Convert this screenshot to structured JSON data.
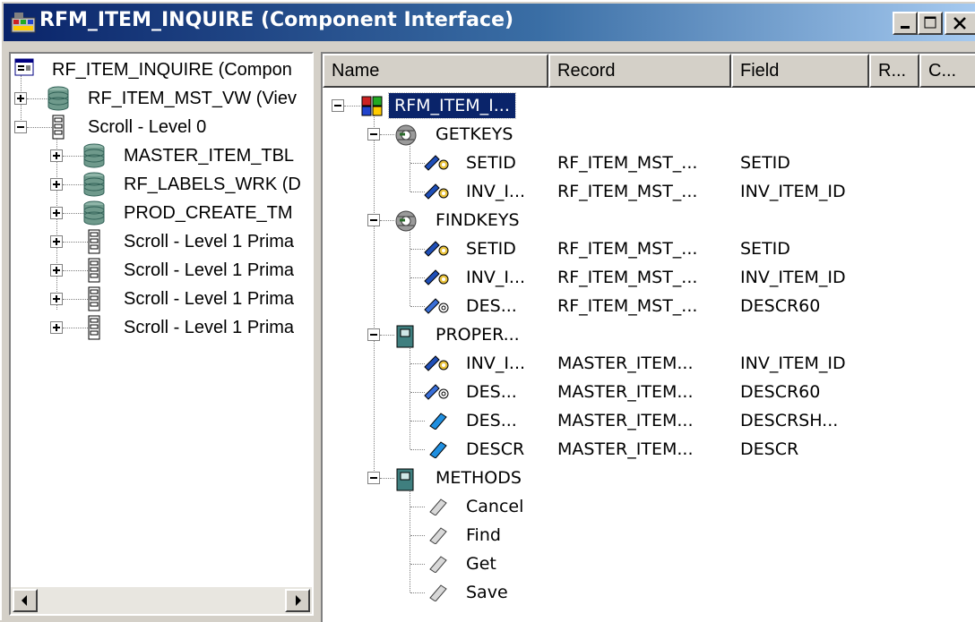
{
  "window": {
    "title": "RFM_ITEM_INQUIRE (Component Interface)",
    "icon": "component-interface-icon"
  },
  "left_tree": [
    {
      "label": "RF_ITEM_INQUIRE (Compon",
      "icon": "component-icon",
      "expander": null
    },
    {
      "label": "RF_ITEM_MST_VW (Viev",
      "icon": "database-icon",
      "expander": "plus"
    },
    {
      "label": "Scroll - Level 0",
      "icon": "scroll-icon",
      "expander": "minus"
    },
    {
      "label": "MASTER_ITEM_TBL",
      "icon": "database-icon",
      "expander": "plus"
    },
    {
      "label": "RF_LABELS_WRK (D",
      "icon": "database-icon",
      "expander": "plus"
    },
    {
      "label": "PROD_CREATE_TM",
      "icon": "database-icon",
      "expander": "plus"
    },
    {
      "label": "Scroll - Level 1  Prima",
      "icon": "scroll-icon",
      "expander": "plus"
    },
    {
      "label": "Scroll - Level 1  Prima",
      "icon": "scroll-icon",
      "expander": "plus"
    },
    {
      "label": "Scroll - Level 1  Prima",
      "icon": "scroll-icon",
      "expander": "plus"
    },
    {
      "label": "Scroll - Level 1  Prima",
      "icon": "scroll-icon",
      "expander": "plus"
    }
  ],
  "columns": [
    "Name",
    "Record",
    "Field",
    "R...",
    "C..."
  ],
  "right_tree": [
    {
      "name": "RFM_ITEM_I...",
      "record": "",
      "field": "",
      "icon": "component-interface-icon",
      "level": 0,
      "selected": true
    },
    {
      "name": "GETKEYS",
      "record": "",
      "field": "",
      "icon": "keys-group-icon",
      "level": 1
    },
    {
      "name": "SETID",
      "record": "RF_ITEM_MST_...",
      "field": "SETID",
      "icon": "key-icon",
      "level": 2
    },
    {
      "name": "INV_I...",
      "record": "RF_ITEM_MST_...",
      "field": "INV_ITEM_ID",
      "icon": "key-icon",
      "level": 2
    },
    {
      "name": "FINDKEYS",
      "record": "",
      "field": "",
      "icon": "keys-group-icon",
      "level": 1
    },
    {
      "name": "SETID",
      "record": "RF_ITEM_MST_...",
      "field": "SETID",
      "icon": "key-icon",
      "level": 2
    },
    {
      "name": "INV_I...",
      "record": "RF_ITEM_MST_...",
      "field": "INV_ITEM_ID",
      "icon": "key-icon",
      "level": 2
    },
    {
      "name": "DES...",
      "record": "RF_ITEM_MST_...",
      "field": "DESCR60",
      "icon": "alt-key-icon",
      "level": 2
    },
    {
      "name": "PROPER...",
      "record": "",
      "field": "",
      "icon": "book-icon",
      "level": 1
    },
    {
      "name": "INV_I...",
      "record": "MASTER_ITEM...",
      "field": "INV_ITEM_ID",
      "icon": "key-icon",
      "level": 2
    },
    {
      "name": "DES...",
      "record": "MASTER_ITEM...",
      "field": "DESCR60",
      "icon": "alt-key-icon",
      "level": 2
    },
    {
      "name": "DES...",
      "record": "MASTER_ITEM...",
      "field": "DESCRSH...",
      "icon": "property-icon",
      "level": 2
    },
    {
      "name": "DESCR",
      "record": "MASTER_ITEM...",
      "field": "DESCR",
      "icon": "property-icon",
      "level": 2
    },
    {
      "name": "METHODS",
      "record": "",
      "field": "",
      "icon": "book-icon",
      "level": 1
    },
    {
      "name": "Cancel",
      "record": "",
      "field": "",
      "icon": "method-icon",
      "level": 2
    },
    {
      "name": "Find",
      "record": "",
      "field": "",
      "icon": "method-icon",
      "level": 2
    },
    {
      "name": "Get",
      "record": "",
      "field": "",
      "icon": "method-icon",
      "level": 2
    },
    {
      "name": "Save",
      "record": "",
      "field": "",
      "icon": "method-icon",
      "level": 2
    }
  ],
  "colors": {
    "title_start": "#0a246a",
    "title_end": "#a6caf0",
    "selection": "#0a246a",
    "face": "#d4d0c8"
  }
}
